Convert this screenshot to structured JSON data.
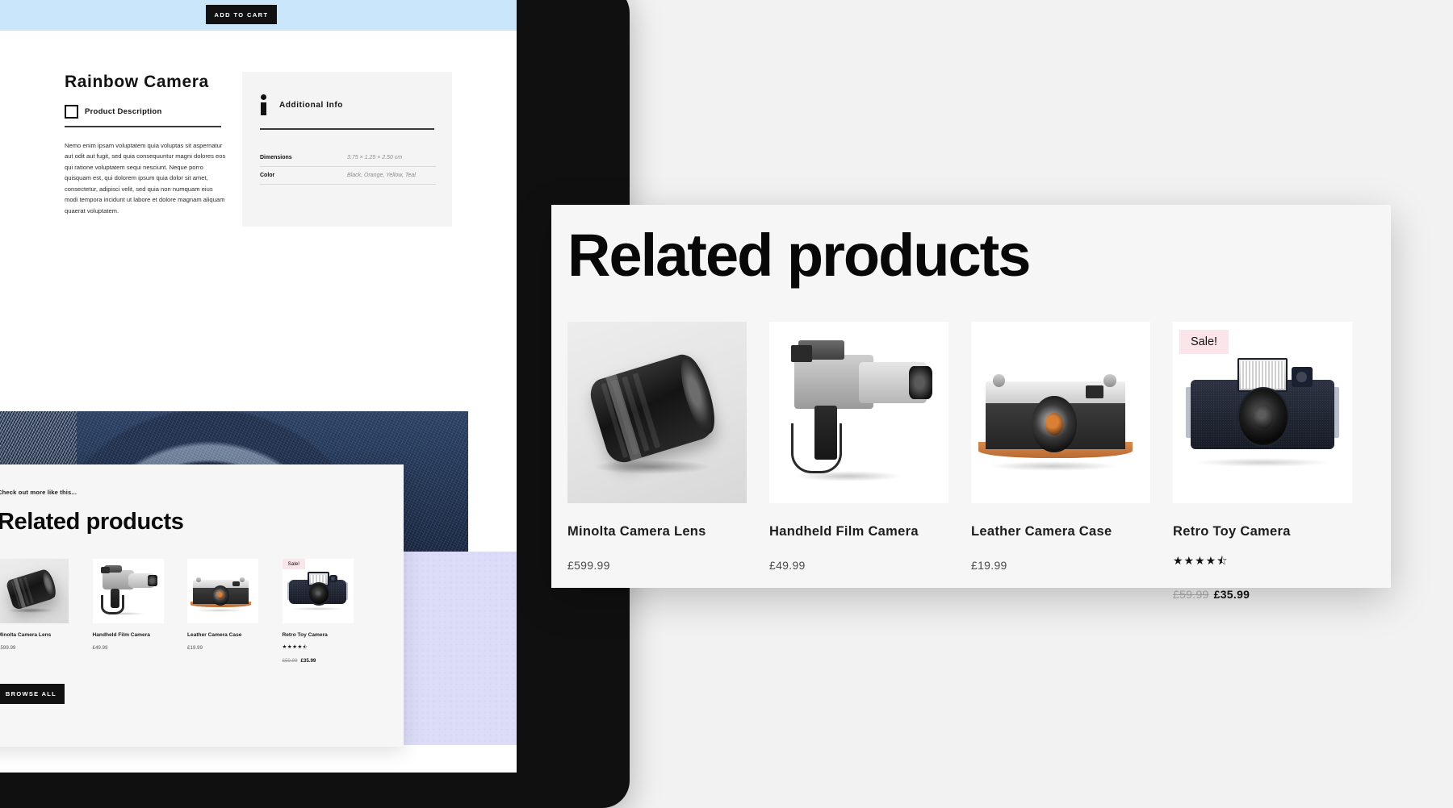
{
  "tablet": {
    "add_to_cart_label": "ADD TO CART",
    "product": {
      "title": "Rainbow Camera",
      "description_label": "Product Description",
      "description_text": "Nemo enim ipsam voluptatem quia voluptas sit aspernatur aut odit aut fugit, sed quia consequuntur magni dolores eos qui ratione voluptatem sequi nesciunt. Neque porro quisquam est, qui dolorem ipsum quia dolor sit amet, consectetur, adipisci velit, sed quia non numquam eius modi tempora incidunt ut labore et dolore magnam aliquam quaerat voluptatem."
    },
    "additional_info": {
      "title": "Additional Info",
      "rows": [
        {
          "key": "Dimensions",
          "value": "3.75 × 1.25 × 2.50 cm"
        },
        {
          "key": "Color",
          "value": "Black, Orange, Yellow, Teal"
        }
      ]
    },
    "related": {
      "eyebrow": "Check out more like this...",
      "heading": "Related products",
      "browse_all_label": "BROWSE ALL"
    }
  },
  "big_panel": {
    "heading": "Related products"
  },
  "products": [
    {
      "name": "Minolta Camera Lens",
      "price": "£599.99",
      "on_sale": false,
      "sale_badge": "",
      "old_price": "",
      "new_price": "",
      "rating": "",
      "art": "lens"
    },
    {
      "name": "Handheld Film Camera",
      "price": "£49.99",
      "on_sale": false,
      "sale_badge": "",
      "old_price": "",
      "new_price": "",
      "rating": "",
      "art": "camcorder"
    },
    {
      "name": "Leather Camera Case",
      "price": "£19.99",
      "on_sale": false,
      "sale_badge": "",
      "old_price": "",
      "new_price": "",
      "rating": "",
      "art": "leather"
    },
    {
      "name": "Retro Toy Camera",
      "price": "",
      "on_sale": true,
      "sale_badge": "Sale!",
      "old_price": "£59.99",
      "new_price": "£35.99",
      "rating": "★★★★⯪",
      "art": "toy"
    }
  ],
  "colors": {
    "accent_lavender": "#dcdcf8",
    "sale_badge_bg": "#fbe4ea",
    "button_black": "#111111",
    "blue_strip": "#c9e6fb",
    "panel_bg": "#f6f6f6"
  }
}
